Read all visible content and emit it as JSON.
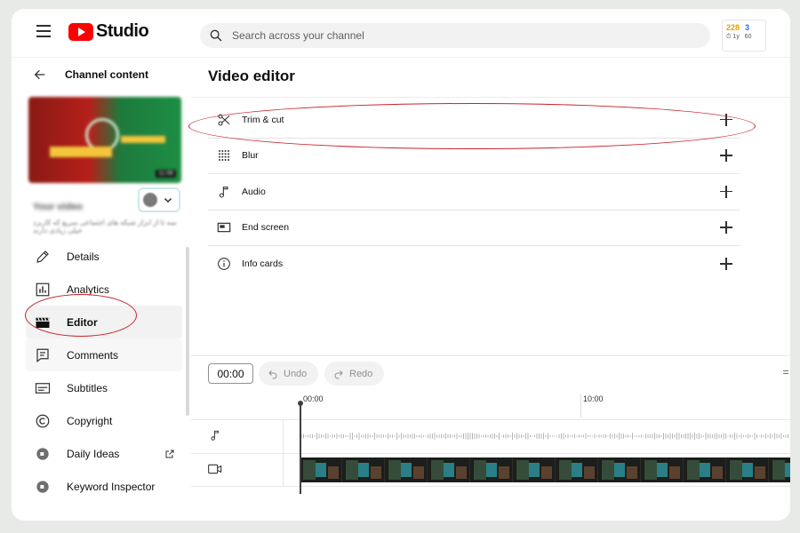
{
  "app": {
    "logo_text": "Studio",
    "brand_color": "#ff0000"
  },
  "search": {
    "placeholder": "Search across your channel"
  },
  "profile_card": {
    "line1_a": "228",
    "line1_b": "3",
    "line2_a": "1y",
    "line2_b": "60"
  },
  "sidebar": {
    "back_label": "Channel content",
    "video": {
      "title": "Your video",
      "subtitle": "سه تا از ابزار شبکه های اجتماعی سریع که کاربرد خیلی زیادی دارند",
      "duration": "11:06"
    },
    "items": [
      {
        "label": "Details",
        "icon": "pencil-icon",
        "active": false
      },
      {
        "label": "Analytics",
        "icon": "analytics-icon",
        "active": false
      },
      {
        "label": "Editor",
        "icon": "clapperboard-icon",
        "active": true
      },
      {
        "label": "Comments",
        "icon": "comments-icon",
        "active": false
      },
      {
        "label": "Subtitles",
        "icon": "subtitles-icon",
        "active": false
      },
      {
        "label": "Copyright",
        "icon": "copyright-icon",
        "active": false
      },
      {
        "label": "Daily Ideas",
        "icon": "extension-icon",
        "active": false
      },
      {
        "label": "Keyword Inspector",
        "icon": "extension-icon",
        "active": false
      }
    ]
  },
  "main": {
    "title": "Video editor",
    "tools": [
      {
        "label": "Trim & cut",
        "icon": "scissors-icon"
      },
      {
        "label": "Blur",
        "icon": "blur-icon"
      },
      {
        "label": "Audio",
        "icon": "music-note-icon"
      },
      {
        "label": "End screen",
        "icon": "end-screen-icon"
      },
      {
        "label": "Info cards",
        "icon": "info-icon"
      }
    ]
  },
  "timeline": {
    "current_time": "00:00",
    "undo_label": "Undo",
    "redo_label": "Redo",
    "ruler": [
      "00:00",
      "10:00"
    ]
  },
  "annotations": {
    "color": "#c8222c",
    "highlighted": [
      "Trim & cut",
      "Editor"
    ]
  }
}
